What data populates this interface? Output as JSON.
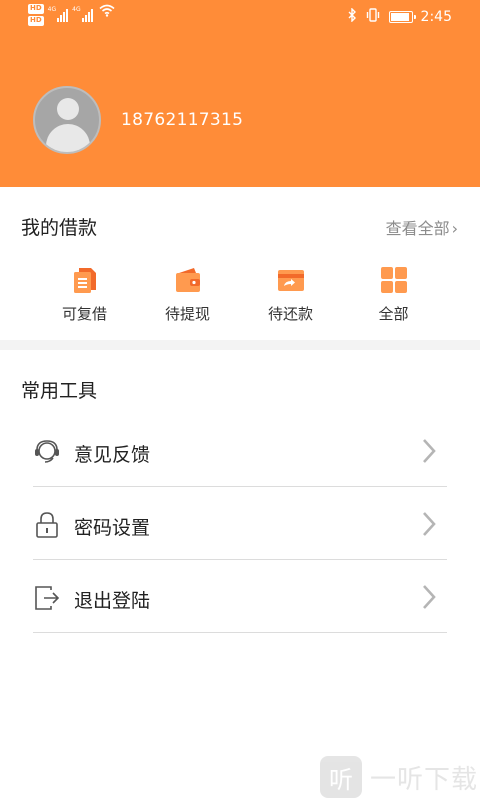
{
  "status_bar": {
    "hd_badges": [
      "HD",
      "HD"
    ],
    "network_labels": [
      "4G",
      "4G"
    ],
    "time": "2:45",
    "battery_level": 0.85
  },
  "profile": {
    "phone": "18762117315"
  },
  "loans": {
    "title": "我的借款",
    "view_all": "查看全部",
    "items": [
      {
        "label": "可复借",
        "icon": "document-icon"
      },
      {
        "label": "待提现",
        "icon": "wallet-icon"
      },
      {
        "label": "待还款",
        "icon": "card-repay-icon"
      },
      {
        "label": "全部",
        "icon": "grid-icon"
      }
    ]
  },
  "tools": {
    "title": "常用工具",
    "items": [
      {
        "label": "意见反馈",
        "icon": "headset-icon"
      },
      {
        "label": "密码设置",
        "icon": "lock-icon"
      },
      {
        "label": "退出登陆",
        "icon": "logout-icon"
      }
    ]
  },
  "watermark": {
    "logo_char": "听",
    "text": "一听下载"
  },
  "colors": {
    "accent": "#ff8c38",
    "text": "#222222",
    "muted": "#8c8c8c"
  }
}
